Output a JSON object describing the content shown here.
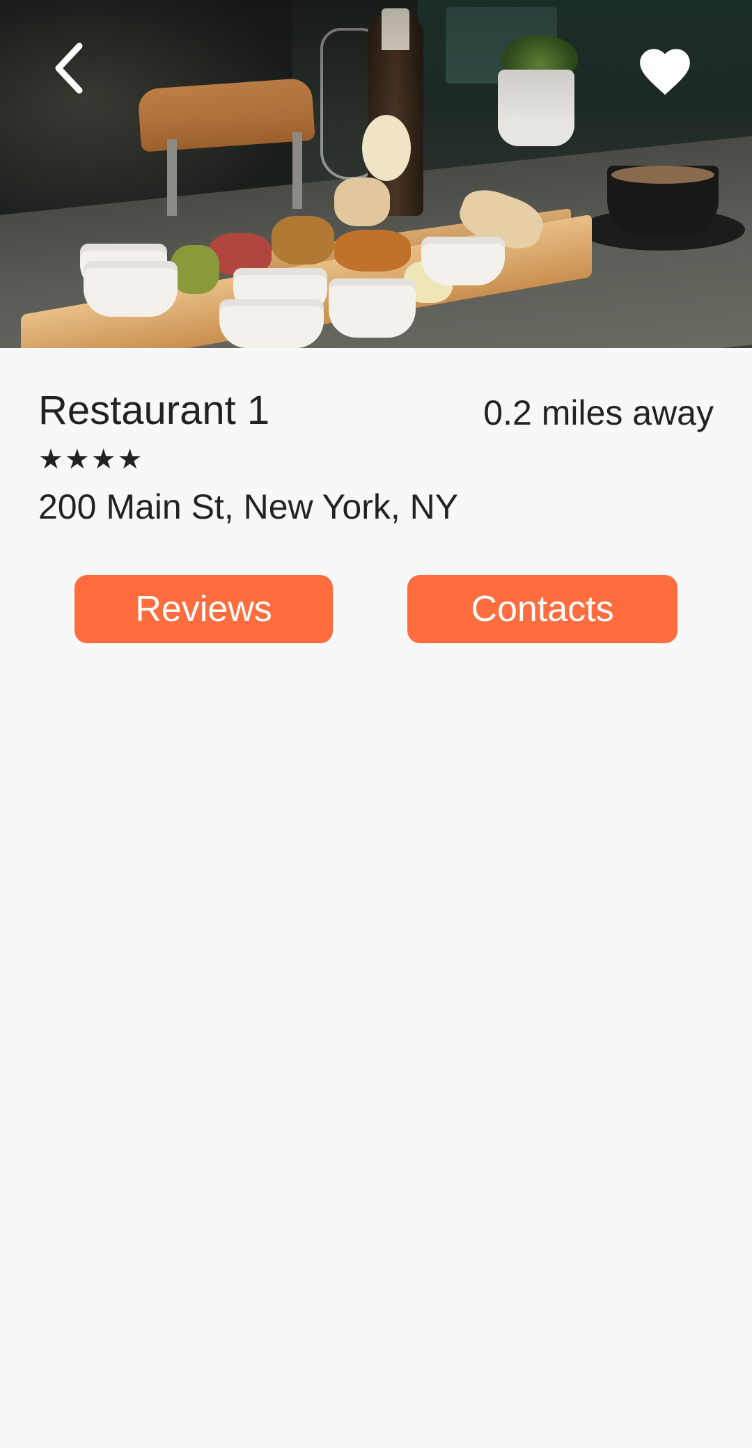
{
  "header": {
    "back_icon": "chevron-left-icon",
    "favorite_icon": "heart-icon",
    "photo": "restaurant-food-photo"
  },
  "restaurant": {
    "name": "Restaurant 1",
    "distance": "0.2 miles away",
    "rating_stars": "★★★★",
    "rating": 4,
    "address": "200 Main St, New York, NY"
  },
  "actions": {
    "reviews_label": "Reviews",
    "contacts_label": "Contacts"
  },
  "colors": {
    "accent": "#ff6d3f",
    "background": "#f8f8f8",
    "text": "#222222"
  }
}
